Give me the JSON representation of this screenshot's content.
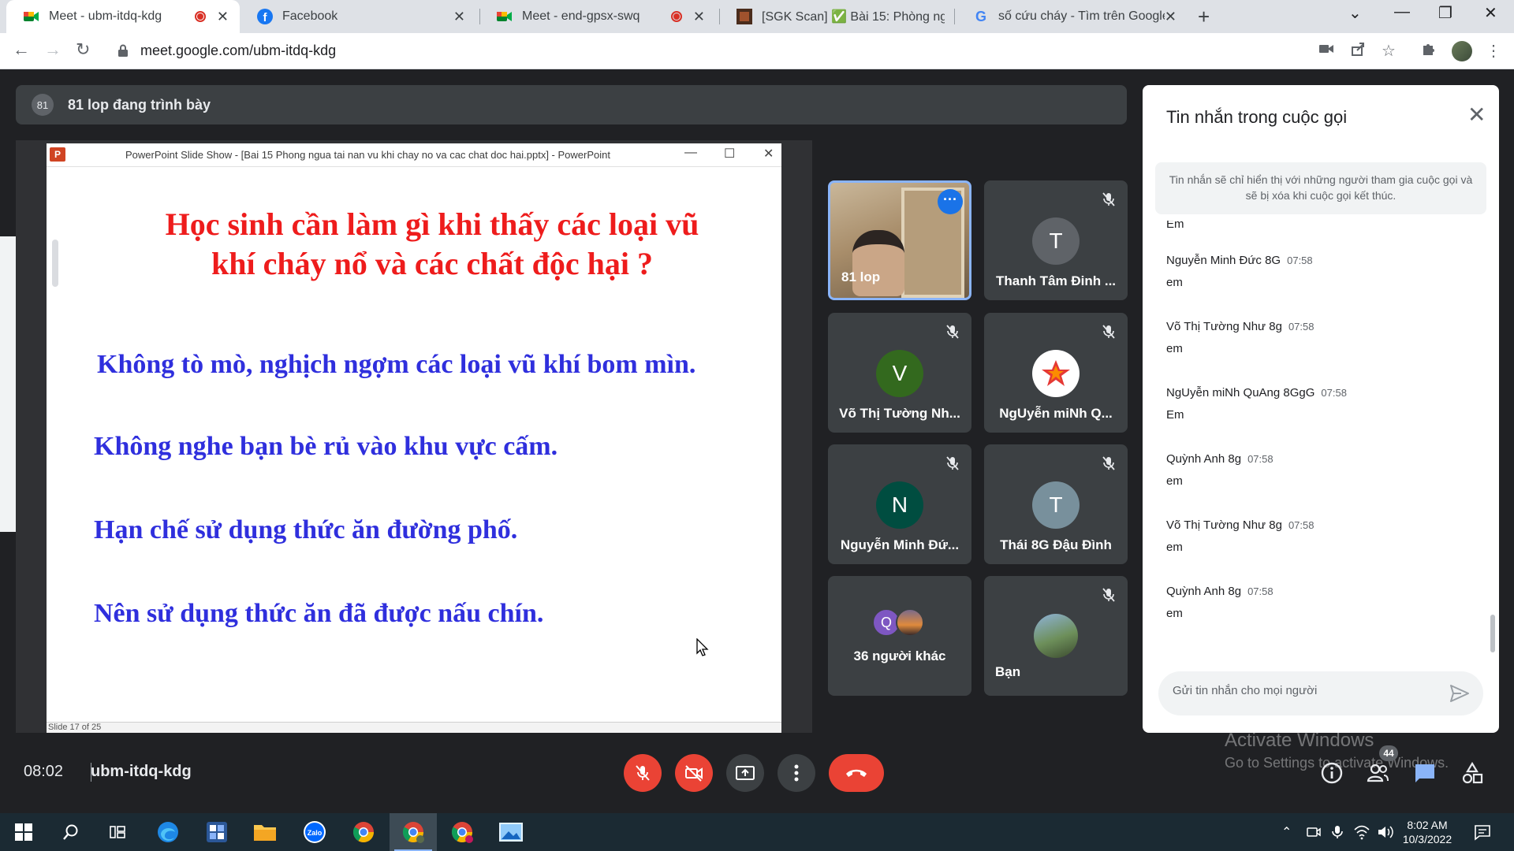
{
  "browser": {
    "tabs": [
      {
        "title": "Meet - ubm-itdq-kdg",
        "icon": "google-meet-icon",
        "recording": true,
        "active": true
      },
      {
        "title": "Facebook",
        "icon": "facebook-icon",
        "recording": false,
        "active": false
      },
      {
        "title": "Meet - end-gpsx-swq",
        "icon": "google-meet-icon",
        "recording": true,
        "active": false
      },
      {
        "title": "[SGK Scan] ✅ Bài 15: Phòng ngừ",
        "icon": "sgk-icon",
        "recording": false,
        "active": false
      },
      {
        "title": "số cứu cháy - Tìm trên Google",
        "icon": "google-icon",
        "recording": false,
        "active": false
      }
    ],
    "url": "meet.google.com/ubm-itdq-kdg"
  },
  "presenter_bar": {
    "badge": "81",
    "text": "81 lop đang trình bày"
  },
  "presentation": {
    "window_title": "PowerPoint Slide Show - [Bai 15 Phong ngua tai nan vu khi chay no va cac chat doc hai.pptx] - PowerPoint",
    "slide_title_line1": "Học sinh cần làm gì khi thấy các loại vũ",
    "slide_title_line2": "khí cháy nổ và các chất độc hại ?",
    "bullets": [
      "Không tò mò, nghịch ngợm các loại vũ khí bom mìn.",
      "Không nghe bạn bè rủ  vào khu vực cấm.",
      "Hạn chế sử dụng thức ăn đường phố.",
      "Nên sử dụng thức ăn đã được nấu chín."
    ],
    "slide_status": "Slide 17 of 25",
    "title_color": "#ee1c1c",
    "bullet_color": "#2f2fdd"
  },
  "participants": [
    {
      "name": "81 lop",
      "avatar_letter": "",
      "avatar_color": "",
      "muted": false,
      "is_self_video": true
    },
    {
      "name": "Thanh Tâm Đinh ...",
      "avatar_letter": "T",
      "avatar_color": "#5f6368",
      "muted": true
    },
    {
      "name": "Võ Thị Tường Nh...",
      "avatar_letter": "V",
      "avatar_color": "#33691e",
      "muted": true
    },
    {
      "name": "NgUyễn miNh Q...",
      "avatar_letter": "",
      "avatar_color": "#ffffff",
      "muted": true,
      "photo": "star-logo-avatar"
    },
    {
      "name": "Nguyễn Minh Đứ...",
      "avatar_letter": "N",
      "avatar_color": "#004d40",
      "muted": true
    },
    {
      "name": "Thái 8G Đậu Đình",
      "avatar_letter": "T",
      "avatar_color": "#78909c",
      "muted": true
    },
    {
      "name": "36 người khác",
      "avatar_letter": "Q",
      "avatar_color": "#7e57c2",
      "muted": false
    },
    {
      "name": "Bạn",
      "avatar_letter": "",
      "avatar_color": "#6d8f5a",
      "muted": true,
      "photo": "self-photo-avatar"
    }
  ],
  "chat": {
    "title": "Tin nhắn trong cuộc gọi",
    "notice": "Tin nhắn sẽ chỉ hiển thị với những người tham gia cuộc gọi và sẽ bị xóa khi cuộc gọi kết thúc.",
    "partial_top": "Em",
    "messages": [
      {
        "sender": "Nguyễn Minh Đức 8G",
        "time": "07:58",
        "text": "em"
      },
      {
        "sender": "Võ Thị Tường Như 8g",
        "time": "07:58",
        "text": "em"
      },
      {
        "sender": "NgUyễn miNh QuAng 8GgG",
        "time": "07:58",
        "text": "Em"
      },
      {
        "sender": "Quỳnh Anh 8g",
        "time": "07:58",
        "text": "em"
      },
      {
        "sender": "Võ Thị Tường Như 8g",
        "time": "07:58",
        "text": "em"
      },
      {
        "sender": "Quỳnh Anh 8g",
        "time": "07:58",
        "text": "em"
      }
    ],
    "input_placeholder": "Gửi tin nhắn cho mọi người"
  },
  "call_bar": {
    "clock": "08:02",
    "meeting_code": "ubm-itdq-kdg",
    "participant_count": "44",
    "mic_state": "muted",
    "camera_state": "off"
  },
  "watermark": {
    "line1": "Activate Windows",
    "line2": "Go to Settings to activate Windows."
  },
  "taskbar": {
    "time": "8:02 AM",
    "date": "10/3/2022",
    "apps": [
      "start-icon",
      "search-icon",
      "task-view-icon",
      "edge-icon",
      "ms-office-icon",
      "file-explorer-icon",
      "zalo-icon",
      "chrome-icon",
      "chrome-profile-icon",
      "chrome-profile-2-icon",
      "photos-icon"
    ]
  },
  "colors": {
    "meet_bg": "#202124",
    "accent_blue": "#8ab4f8",
    "danger_red": "#ea4335"
  }
}
